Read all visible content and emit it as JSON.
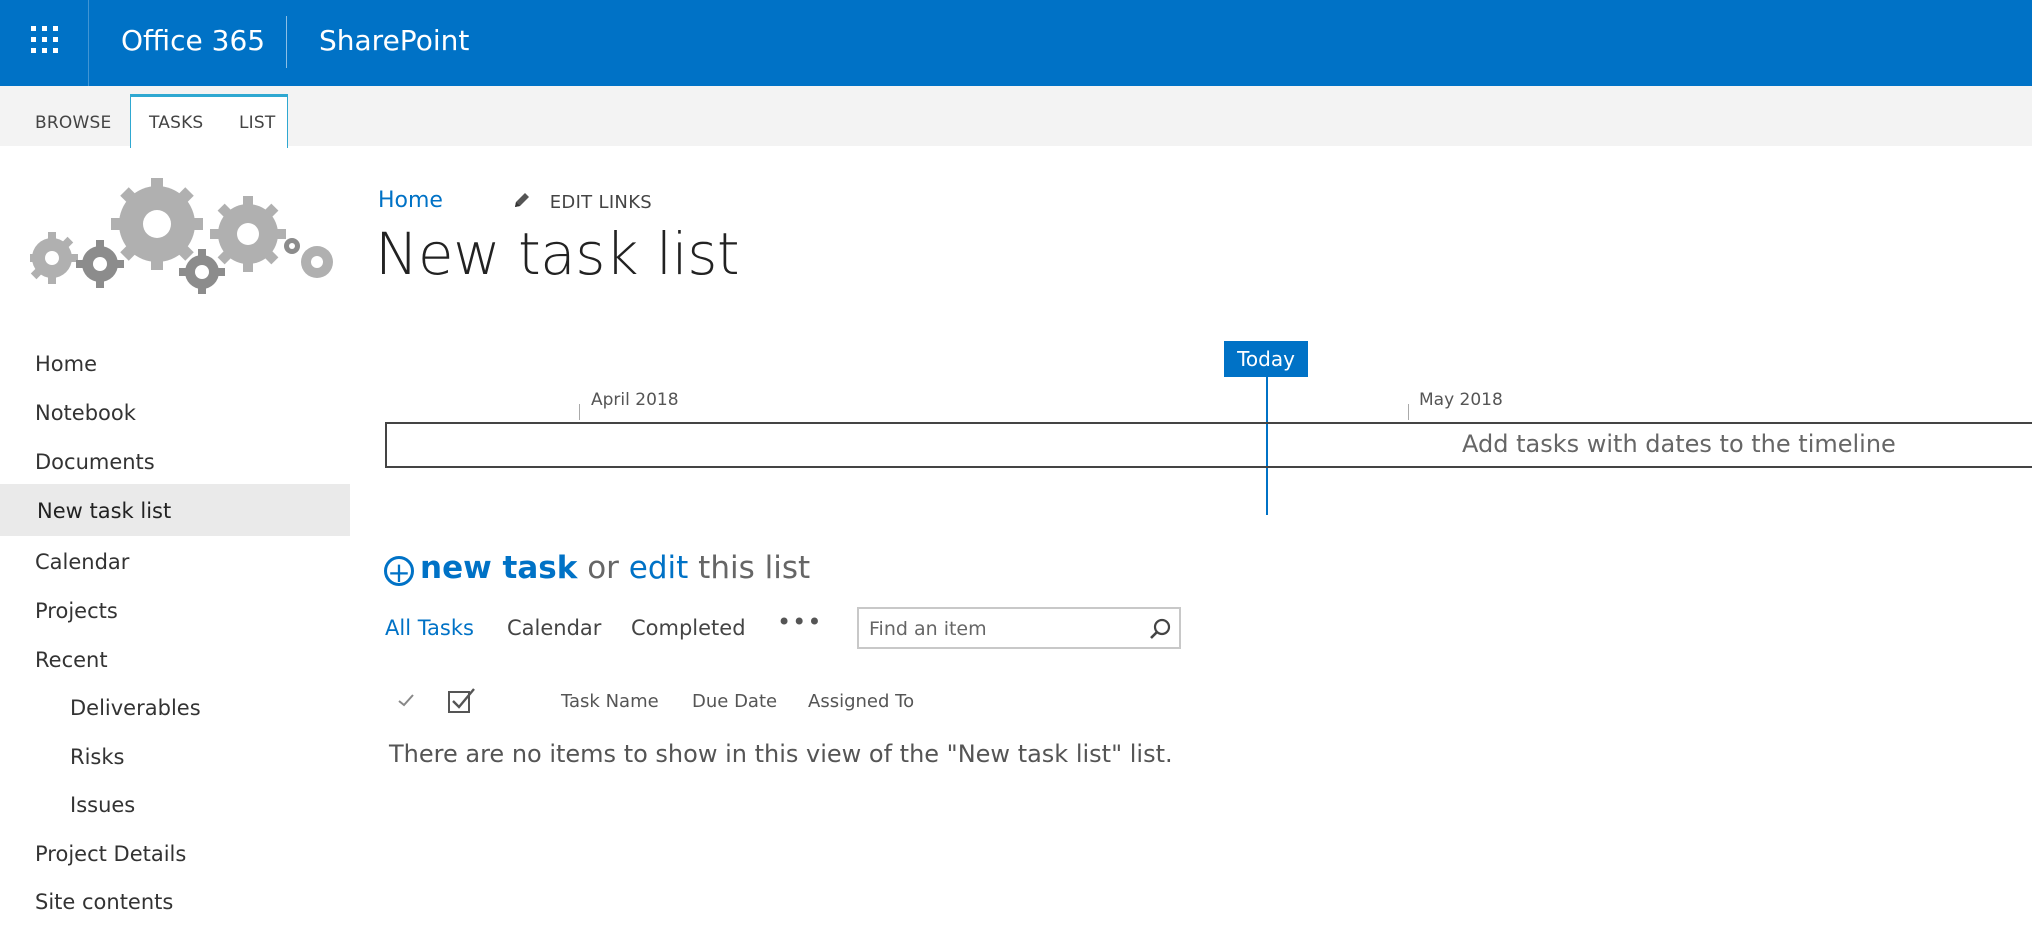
{
  "suite_bar": {
    "app_launcher_icon": "waffle-icon",
    "office_label": "Office 365",
    "site_label": "SharePoint",
    "color": "#0072c6"
  },
  "ribbon": {
    "tabs": [
      {
        "label": "BROWSE",
        "selected": false
      },
      {
        "label": "TASKS",
        "selected": false
      },
      {
        "label": "LIST",
        "selected": false
      }
    ],
    "group_accent": "#2fa8d1"
  },
  "site_logo": {
    "icon": "gears-icon"
  },
  "breadcrumb": {
    "home": "Home",
    "edit_links": "EDIT LINKS",
    "edit_icon": "pencil-icon"
  },
  "page_title": "New task list",
  "left_nav": {
    "items": [
      {
        "label": "Home"
      },
      {
        "label": "Notebook"
      },
      {
        "label": "Documents"
      },
      {
        "label": "New task list",
        "selected": true
      },
      {
        "label": "Calendar"
      },
      {
        "label": "Projects"
      },
      {
        "label": "Recent"
      },
      {
        "label": "Deliverables",
        "sub": true
      },
      {
        "label": "Risks",
        "sub": true
      },
      {
        "label": "Issues",
        "sub": true
      },
      {
        "label": "Project Details"
      },
      {
        "label": "Site contents"
      }
    ]
  },
  "timeline": {
    "today_label": "Today",
    "months": [
      "April 2018",
      "May 2018"
    ],
    "empty_message": "Add tasks with dates to the timeline"
  },
  "command": {
    "new_task": "new task",
    "or": "or",
    "edit": "edit",
    "this_list": "this list"
  },
  "views": {
    "tabs": [
      {
        "label": "All Tasks",
        "active": true
      },
      {
        "label": "Calendar",
        "active": false
      },
      {
        "label": "Completed",
        "active": false
      }
    ],
    "more_label": "•••",
    "search_placeholder": "Find an item"
  },
  "list": {
    "columns": [
      "Task Name",
      "Due Date",
      "Assigned To"
    ],
    "empty_message": "There are no items to show in this view of the \"New task list\" list."
  }
}
